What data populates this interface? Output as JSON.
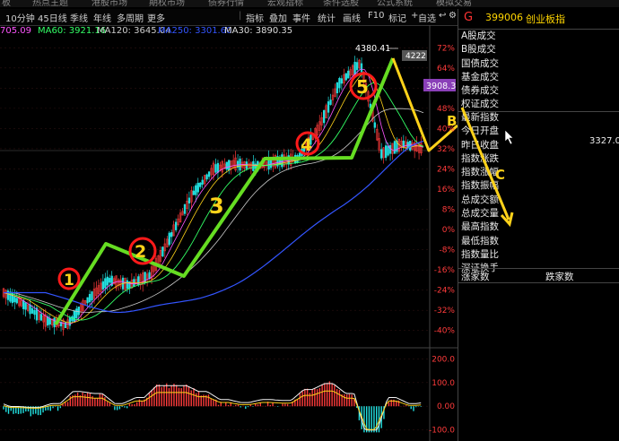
{
  "top_strip": [
    "板",
    "热点主题",
    "港股市场",
    "期权市场",
    "债券行情",
    "宏观指标",
    "条件选股",
    "公式系统",
    "模拟交易"
  ],
  "toolbar": {
    "periods": [
      "10分钟",
      "45日线",
      "季线",
      "年线",
      "多周期",
      "更多"
    ],
    "tools": [
      "指标",
      "叠加",
      "事件",
      "统计",
      "画线",
      "F10",
      "标记",
      "+",
      "自选"
    ],
    "icons": [
      "return-icon",
      "settings-icon"
    ]
  },
  "ma_legend": [
    {
      "label": "705.09",
      "color": "#ff55ff"
    },
    {
      "label": "MA60: 3921.16",
      "color": "#33ff66"
    },
    {
      "label": "MA120: 3645.04",
      "color": "#cccccc"
    },
    {
      "label": "MA250: 3301.60",
      "color": "#3355ff"
    },
    {
      "label": "MA30: 3890.35",
      "color": "#dddddd"
    }
  ],
  "price_axis": [
    "72%",
    "64%",
    "56%",
    "48%",
    "40%",
    "32%",
    "24%",
    "16%",
    "8%",
    "0%",
    "-8%",
    "-16%",
    "-24%",
    "-32%",
    "-40%"
  ],
  "price_labels": {
    "high": "4380.41",
    "near_high": "4222",
    "current": "3908.3"
  },
  "indicator_axis": [
    "200.0",
    "100.0",
    "0.00",
    "-100.0"
  ],
  "annotations": [
    "1",
    "2",
    "3",
    "4",
    "5",
    "B",
    "C"
  ],
  "panel": {
    "marker": "G",
    "code": "399006",
    "name": "创业板指",
    "group1": [
      "A股成交",
      "B股成交",
      "国债成交",
      "基金成交",
      "债券成交",
      "权证成交"
    ],
    "group2": [
      "最新指数",
      "今日开盘",
      "昨日收盘",
      "指数涨跌",
      "指数涨幅",
      "指数振幅",
      "总成交额",
      "总成交量",
      "最高指数",
      "最低指数",
      "指数量比",
      "深证换手"
    ],
    "close_value": "3327.0",
    "footer_left": "涨家数",
    "footer_right": "跌家数"
  },
  "colors": {
    "up": "#ff3b3b",
    "down": "#22e0e0",
    "wave": "#66dd22",
    "correction": "#ffd21a",
    "circle": "#ff1a1a",
    "number": "#ffd21a",
    "ma250": "#3355ff",
    "current_tag": "#8a3fb8"
  },
  "chart_data": {
    "type": "line",
    "title": "",
    "xlabel": "",
    "ylabel": "",
    "y_unit": "percent change",
    "ylim": [
      -44,
      76
    ],
    "x": [
      0,
      10,
      20,
      30,
      40,
      50,
      60,
      70,
      80,
      90,
      100,
      110,
      120,
      130,
      140,
      150,
      160,
      170,
      180,
      190,
      200
    ],
    "series": [
      {
        "values": [
          -25,
          -30,
          -36,
          -38,
          -28,
          -20,
          -22,
          -18,
          -2,
          14,
          24,
          26,
          25,
          27,
          28,
          40,
          58,
          66,
          30,
          34,
          32
        ]
      }
    ],
    "indicator": {
      "ylim": [
        -120,
        220
      ],
      "gridlines": [
        200,
        100,
        0,
        -100
      ]
    }
  }
}
